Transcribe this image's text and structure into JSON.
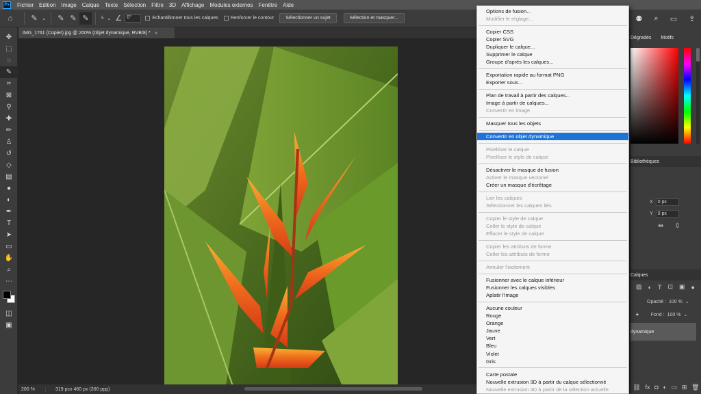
{
  "menubar": {
    "items": [
      "Fichier",
      "Edition",
      "Image",
      "Calque",
      "Texte",
      "Sélection",
      "Filtre",
      "3D",
      "Affichage",
      "Modules externes",
      "Fenêtre",
      "Aide"
    ]
  },
  "options": {
    "brush_size": "5",
    "angle": "0°",
    "sample_all_layers": "Echantillonner tous les calques",
    "enhance_edge": "Renforcer le contour",
    "select_subject": "Sélectionner un sujet",
    "select_and_mask": "Sélection et masquer..."
  },
  "document": {
    "tab_title": "IMG_1761 (Copier).jpg @ 200% (objet dynamique, RVB/8) *",
    "zoom": "200 %",
    "info": "319 pcx 460 px (300 ppp)"
  },
  "panels": {
    "tab_gradients": "Dégradés",
    "tab_patterns": "Motifs",
    "libraries": "Bibliothèques",
    "props_x_label": "X",
    "props_x_value": "0 px",
    "props_y_label": "Y",
    "props_y_value": "0 px",
    "layers_header": "Calques",
    "opacity_label": "Opacité :",
    "opacity_value": "100 %",
    "fill_label": "Fond :",
    "fill_value": "100 %",
    "layer_name": "dynamique"
  },
  "context_menu": {
    "groups": [
      [
        {
          "label": "Options de fusion...",
          "disabled": false
        },
        {
          "label": "Modifier le réglage...",
          "disabled": true
        }
      ],
      [
        {
          "label": "Copier CSS",
          "disabled": false
        },
        {
          "label": "Copier SVG",
          "disabled": false
        },
        {
          "label": "Dupliquer le calque...",
          "disabled": false
        },
        {
          "label": "Supprimer le calque",
          "disabled": false
        },
        {
          "label": "Groupe d'après les calques...",
          "disabled": false
        }
      ],
      [
        {
          "label": "Exportation rapide au format PNG",
          "disabled": false
        },
        {
          "label": "Exporter sous...",
          "disabled": false
        }
      ],
      [
        {
          "label": "Plan de travail à partir des calques...",
          "disabled": false
        },
        {
          "label": "Image à partir de calques...",
          "disabled": false
        },
        {
          "label": "Convertir en image",
          "disabled": true
        }
      ],
      [
        {
          "label": "Masquer tous les objets",
          "disabled": false
        }
      ],
      [
        {
          "label": "Convertir en objet dynamique",
          "disabled": false,
          "highlighted": true
        }
      ],
      [
        {
          "label": "Pixelliser le calque",
          "disabled": true
        },
        {
          "label": "Pixelliser le style de calque",
          "disabled": true
        }
      ],
      [
        {
          "label": "Désactiver le masque de fusion",
          "disabled": false
        },
        {
          "label": "Activer le masque vectoriel",
          "disabled": true
        },
        {
          "label": "Créer un masque d'écrêtage",
          "disabled": false
        }
      ],
      [
        {
          "label": "Lier les calques",
          "disabled": true
        },
        {
          "label": "Sélectionner les calques liés",
          "disabled": true
        }
      ],
      [
        {
          "label": "Copier le style de calque",
          "disabled": true
        },
        {
          "label": "Coller le style de calque",
          "disabled": true
        },
        {
          "label": "Effacer le style de calque",
          "disabled": true
        }
      ],
      [
        {
          "label": "Copier les attributs de forme",
          "disabled": true
        },
        {
          "label": "Coller les attributs de forme",
          "disabled": true
        }
      ],
      [
        {
          "label": "Annuler l'isolement",
          "disabled": true
        }
      ],
      [
        {
          "label": "Fusionner avec le calque inférieur",
          "disabled": false
        },
        {
          "label": "Fusionner les calques visibles",
          "disabled": false
        },
        {
          "label": "Aplatir l'image",
          "disabled": false
        }
      ],
      [
        {
          "label": "Aucune couleur",
          "disabled": false
        },
        {
          "label": "Rouge",
          "disabled": false
        },
        {
          "label": "Orange",
          "disabled": false
        },
        {
          "label": "Jaune",
          "disabled": false
        },
        {
          "label": "Vert",
          "disabled": false
        },
        {
          "label": "Bleu",
          "disabled": false
        },
        {
          "label": "Violet",
          "disabled": false
        },
        {
          "label": "Gris",
          "disabled": false
        }
      ],
      [
        {
          "label": "Carte postale",
          "disabled": false
        },
        {
          "label": "Nouvelle extrusion 3D à partir du calque sélectionné",
          "disabled": false
        },
        {
          "label": "Nouvelle extrusion 3D à partir de la sélection actuelle",
          "disabled": true
        }
      ]
    ]
  },
  "colors": {
    "accent": "#1e74d6",
    "ui_dark": "#3c3c3c",
    "menubar": "#535353"
  }
}
